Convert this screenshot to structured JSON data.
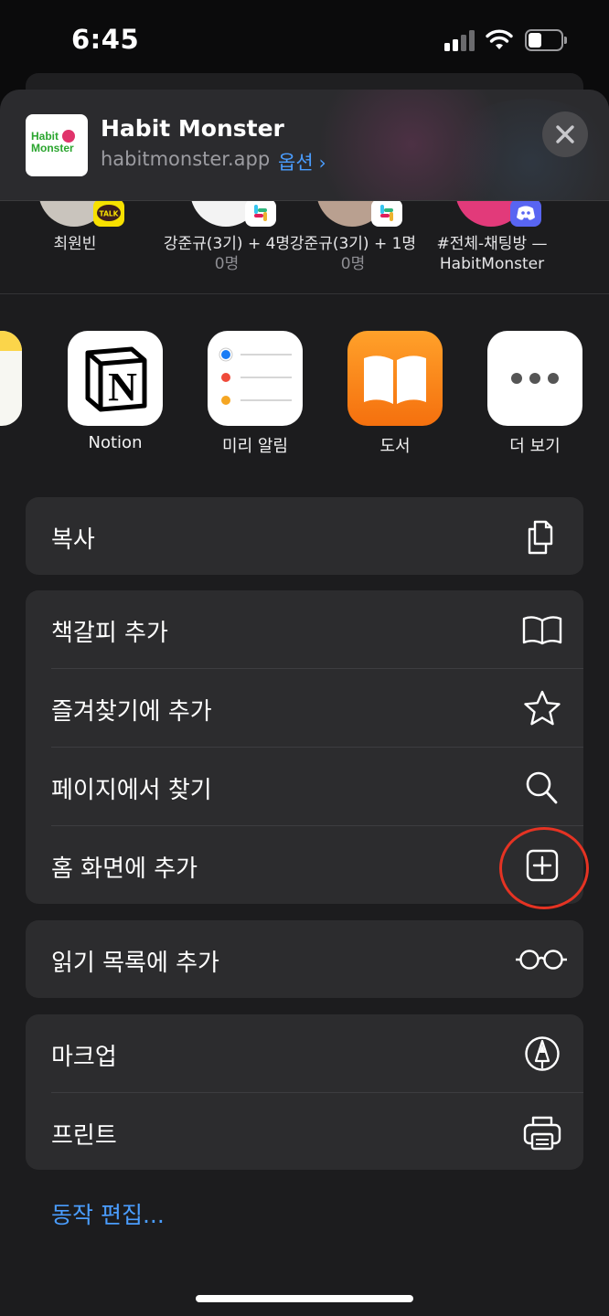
{
  "status_bar": {
    "time": "6:45"
  },
  "header": {
    "site_title": "Habit Monster",
    "site_url": "habitmonster.app",
    "options_label": "옵션",
    "logo_text_line1": "Habit",
    "logo_text_line2": "Monster"
  },
  "people": [
    {
      "name": "최원빈",
      "sub": "",
      "app": "KakaoTalk",
      "badge_text": "TALK"
    },
    {
      "name": "강준규(3기) + 4명",
      "sub": "0명",
      "app": "Slack"
    },
    {
      "name": "강준규(3기) + 1명",
      "sub": "0명",
      "app": "Slack"
    },
    {
      "name": "#전체-채팅방 —",
      "sub": "HabitMonster",
      "app": "Discord"
    }
  ],
  "apps": [
    {
      "label": "Notion",
      "icon": "notion-icon"
    },
    {
      "label": "미리 알림",
      "icon": "reminders-icon"
    },
    {
      "label": "도서",
      "icon": "books-icon"
    },
    {
      "label": "더 보기",
      "icon": "more-icon"
    }
  ],
  "actions": {
    "copy": "복사",
    "add_bookmark": "책갈피 추가",
    "add_favorites": "즐겨찾기에 추가",
    "find_on_page": "페이지에서 찾기",
    "add_to_home": "홈 화면에 추가",
    "add_reading_list": "읽기 목록에 추가",
    "markup": "마크업",
    "print": "프린트"
  },
  "edit_actions": "동작 편집...",
  "colors": {
    "accent_blue": "#4a9dff",
    "highlight_red": "#e53323",
    "sheet_bg": "#1c1c1e",
    "row_bg": "#2c2c2e"
  }
}
